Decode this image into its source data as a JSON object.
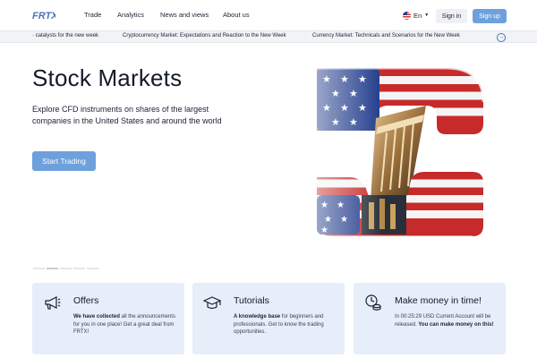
{
  "brand": {
    "logo_text": "FRTX"
  },
  "nav": {
    "items": [
      {
        "label": "Trade"
      },
      {
        "label": "Analytics"
      },
      {
        "label": "News and views"
      },
      {
        "label": "About us"
      }
    ],
    "language": "En",
    "signin_label": "Sign in",
    "signup_label": "Sign up"
  },
  "ticker": {
    "items": [
      {
        "label": "catalysts for the new week"
      },
      {
        "label": "Cryptocurrency Market: Expectations and Reaction to the New Week"
      },
      {
        "label": "Currency Market: Technicals and Scenarios for the New Week"
      }
    ],
    "next_icon": "arrow-right-circle-icon"
  },
  "hero": {
    "title": "Stock Markets",
    "subtitle": "Explore CFD instruments on shares of the largest companies in the United States and around the world",
    "cta_label": "Start Trading",
    "slides": {
      "count": 5,
      "active_index": 1
    }
  },
  "cards": [
    {
      "icon": "megaphone-icon",
      "title": "Offers",
      "text_strong": "We have collected",
      "text": " all the announcements for you in one place! Get a great deal from FRTX!"
    },
    {
      "icon": "graduation-cap-icon",
      "title": "Tutorials",
      "text_strong": "A knowledge base",
      "text": " for beginners and professionals. Get to know the trading opportunities."
    },
    {
      "icon": "clock-coins-icon",
      "title": "Make money in time!",
      "text": "In 00:25:29 USD Current Account will be released. ",
      "text_strong": "You can make money on this!"
    }
  ],
  "colors": {
    "accent": "#6ea0dc",
    "card_bg": "#e6eef9",
    "ticker_bg": "#f1f3f6",
    "text": "#1c2233"
  }
}
